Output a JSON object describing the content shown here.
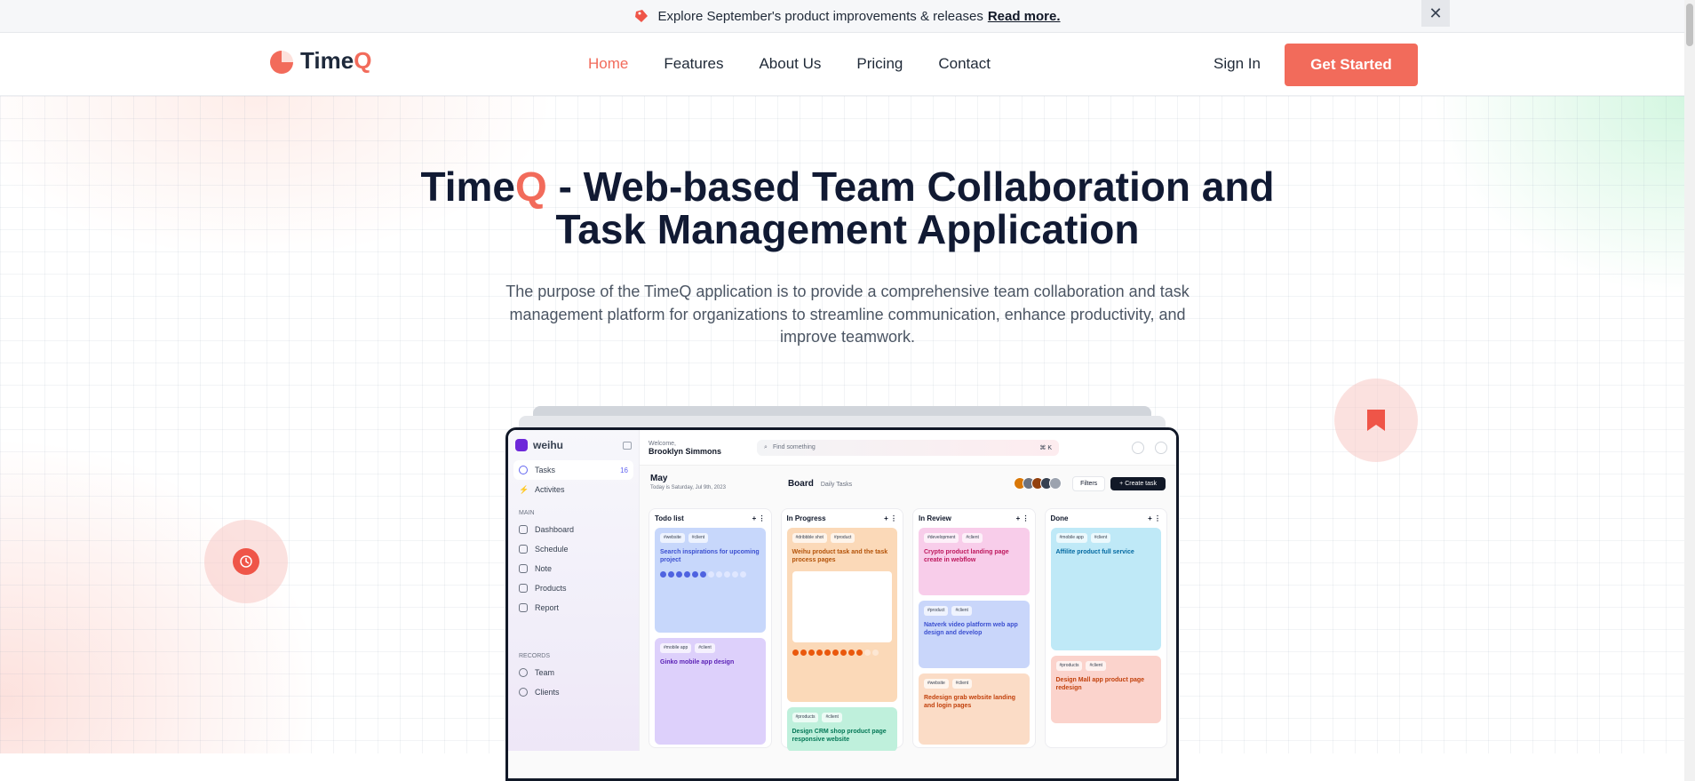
{
  "announcement": {
    "text": "Explore September's product improvements & releases",
    "link": "Read more.",
    "close": "✕"
  },
  "nav": {
    "brand_main": "Time",
    "brand_q": "Q",
    "links": [
      "Home",
      "Features",
      "About Us",
      "Pricing",
      "Contact"
    ],
    "active": "Home",
    "signin": "Sign In",
    "cta": "Get Started"
  },
  "hero": {
    "title_pre": "Time",
    "title_q": "Q",
    "title_line1_rest": " - Web-based Team Collaboration and",
    "title_line2": "Task Management Application",
    "subtitle": "The purpose of the TimeQ application is to provide a comprehensive team collaboration and task management platform for organizations to streamline communication, enhance productivity, and improve teamwork."
  },
  "preview": {
    "brand": "weihu",
    "welcome": "Welcome,",
    "user": "Brooklyn Simmons",
    "search_placeholder": "Find something",
    "search_kbd": "⌘ K",
    "sidebar": {
      "top": [
        {
          "label": "Tasks",
          "count": "16"
        },
        {
          "label": "Activites"
        }
      ],
      "main_label": "MAIN",
      "main": [
        "Dashboard",
        "Schedule",
        "Note",
        "Products",
        "Report"
      ],
      "records_label": "RECORDS",
      "records": [
        "Team",
        "Clients"
      ]
    },
    "month": "May",
    "date": "Today is Saturday, Jul 9th, 2023",
    "board": "Board",
    "board_view": "Daily Tasks",
    "filters": "Filters",
    "create": "+ Create task",
    "columns": [
      {
        "title": "Todo list",
        "cards": [
          {
            "tags": [
              "#website",
              "#client"
            ],
            "title": "Search inspirations for upcoming project",
            "color": "#c7d7fb"
          },
          {
            "tags": [
              "#mobile app",
              "#client"
            ],
            "title": "Ginko mobile app design",
            "color": "#ddd0fb"
          }
        ]
      },
      {
        "title": "In Progress",
        "cards": [
          {
            "tags": [
              "#dribbble shot",
              "#product"
            ],
            "title": "Weihu product task and the task process pages",
            "color": "#fbd9b8"
          },
          {
            "tags": [
              "#products",
              "#client"
            ],
            "title": "Design CRM shop product page responsive website",
            "color": "#bff0dc"
          }
        ]
      },
      {
        "title": "In Review",
        "cards": [
          {
            "tags": [
              "#development",
              "#client"
            ],
            "title": "Crypto product landing page create in webflow",
            "color": "#f8cdea"
          },
          {
            "tags": [
              "#product",
              "#client"
            ],
            "title": "Natverk video platform web app design and develop",
            "color": "#c9d6fa"
          },
          {
            "tags": [
              "#website",
              "#client"
            ],
            "title": "Redesign grab website landing and login pages",
            "color": "#fbdcc6"
          }
        ]
      },
      {
        "title": "Done",
        "cards": [
          {
            "tags": [
              "#mobile app",
              "#client"
            ],
            "title": "Affilite product full service",
            "color": "#bfe9f7"
          },
          {
            "tags": [
              "#products",
              "#client"
            ],
            "title": "Design Mall app product page redesign",
            "color": "#fbd3cc"
          }
        ]
      }
    ]
  },
  "colors": {
    "accent": "#f26b5b",
    "dark": "#111a33"
  }
}
